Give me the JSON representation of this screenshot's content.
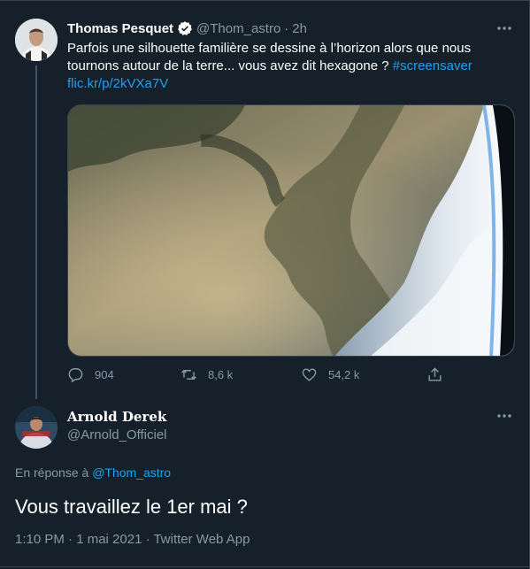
{
  "tweet": {
    "author_name": "Thomas Pesquet",
    "author_handle": "@Thom_astro",
    "separator": "·",
    "time": "2h",
    "text_line1": "Parfois une silhouette familière se dessine à l’horizon alors que nous",
    "text_line2_plain": "tournons autour de la terre... vous avez dit hexagone ? ",
    "hashtag": "#screensaver",
    "link": "flic.kr/p/2kVXa7V",
    "media_icon": "earth-from-space-photo",
    "replies": "904",
    "retweets": "8,6 k",
    "likes": "54,2 k"
  },
  "reply": {
    "author_name": "Arnold Derek",
    "author_handle": "@Arnold_Officiel",
    "reply_prefix": "En réponse à",
    "reply_target": "@Thom_astro",
    "text": "Vous travaillez le 1er mai ?",
    "meta": "1:10 PM · 1 mai 2021 · Twitter Web App"
  },
  "colors": {
    "background": "#15202b",
    "accent": "#1da1f2",
    "secondary_text": "#8899a6",
    "border": "#38444d"
  }
}
